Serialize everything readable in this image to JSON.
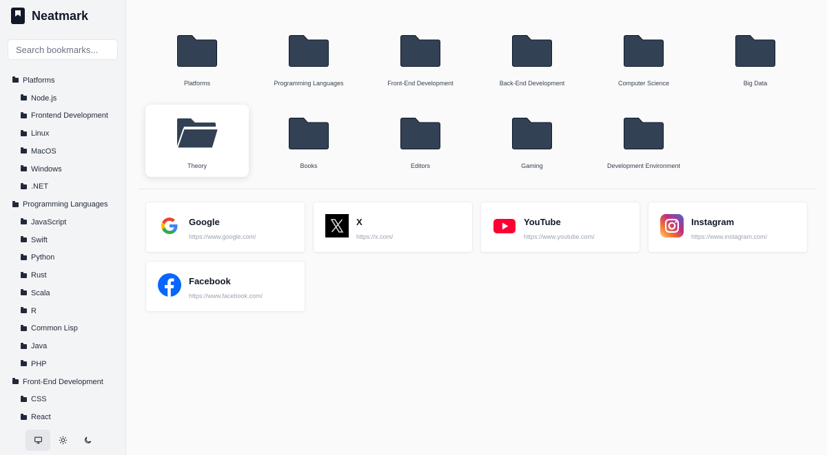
{
  "app": {
    "title": "Neatmark"
  },
  "search": {
    "placeholder": "Search bookmarks..."
  },
  "sidebar": {
    "tree": [
      {
        "label": "Platforms",
        "level": 0
      },
      {
        "label": "Node.js",
        "level": 1
      },
      {
        "label": "Frontend Development",
        "level": 1
      },
      {
        "label": "Linux",
        "level": 1
      },
      {
        "label": "MacOS",
        "level": 1
      },
      {
        "label": "Windows",
        "level": 1
      },
      {
        "label": ".NET",
        "level": 1
      },
      {
        "label": "Programming Languages",
        "level": 0
      },
      {
        "label": "JavaScript",
        "level": 1
      },
      {
        "label": "Swift",
        "level": 1
      },
      {
        "label": "Python",
        "level": 1
      },
      {
        "label": "Rust",
        "level": 1
      },
      {
        "label": "Scala",
        "level": 1
      },
      {
        "label": "R",
        "level": 1
      },
      {
        "label": "Common Lisp",
        "level": 1
      },
      {
        "label": "Java",
        "level": 1
      },
      {
        "label": "PHP",
        "level": 1
      },
      {
        "label": "Front-End Development",
        "level": 0
      },
      {
        "label": "CSS",
        "level": 1
      },
      {
        "label": "React",
        "level": 1
      }
    ]
  },
  "theme": {
    "options": [
      {
        "name": "system-theme-button",
        "icon": "monitor-icon",
        "active": true
      },
      {
        "name": "light-theme-button",
        "icon": "sun-icon",
        "active": false
      },
      {
        "name": "dark-theme-button",
        "icon": "moon-icon",
        "active": false
      }
    ]
  },
  "folders": [
    {
      "label": "Platforms",
      "open": false
    },
    {
      "label": "Programming Languages",
      "open": false
    },
    {
      "label": "Front-End Development",
      "open": false
    },
    {
      "label": "Back-End Development",
      "open": false
    },
    {
      "label": "Computer Science",
      "open": false
    },
    {
      "label": "Big Data",
      "open": false
    },
    {
      "label": "Theory",
      "open": true,
      "selected": true
    },
    {
      "label": "Books",
      "open": false
    },
    {
      "label": "Editors",
      "open": false
    },
    {
      "label": "Gaming",
      "open": false
    },
    {
      "label": "Development Environment",
      "open": false
    }
  ],
  "bookmarks": [
    {
      "title": "Google",
      "url": "https://www.google.com/",
      "icon": "google-icon"
    },
    {
      "title": "X",
      "url": "https://x.com/",
      "icon": "x-icon"
    },
    {
      "title": "YouTube",
      "url": "https://www.youtube.com/",
      "icon": "youtube-icon"
    },
    {
      "title": "Instagram",
      "url": "https://www.instagram.com/",
      "icon": "instagram-icon"
    },
    {
      "title": "Facebook",
      "url": "https://www.facebook.com/",
      "icon": "facebook-icon"
    }
  ],
  "colors": {
    "folder": "#334155",
    "google_blue": "#4285F4",
    "google_red": "#EA4335",
    "google_yellow": "#FBBC05",
    "google_green": "#34A853",
    "youtube_red": "#FF0033",
    "facebook_blue": "#0866FF"
  }
}
